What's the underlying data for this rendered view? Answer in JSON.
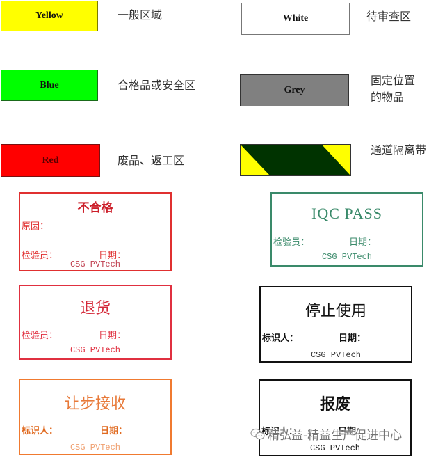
{
  "color_legend": [
    {
      "swatch_label": "Yellow",
      "description": "一般区域",
      "color": "#ffff00"
    },
    {
      "swatch_label": "White",
      "description": "待审查区",
      "color": "#ffffff"
    },
    {
      "swatch_label": "Blue",
      "description": "合格品或安全区",
      "color": "#00ff00"
    },
    {
      "swatch_label": "Grey",
      "description": "固定位置的物品",
      "description_lines": [
        "固定位置",
        "的物品"
      ],
      "color": "#808080"
    },
    {
      "swatch_label": "Red",
      "description": "废品、返工区",
      "color": "#ff0000"
    },
    {
      "swatch_label": "",
      "description": "通道隔离带",
      "color": "#003300",
      "stripe_color": "#ffff00"
    }
  ],
  "labels": [
    {
      "title": "不合格",
      "fields": [
        "原因：",
        "检验员：",
        "日期："
      ],
      "footer": "CSG PVTech",
      "color": "#e03030"
    },
    {
      "title": "IQC PASS",
      "fields": [
        "检验员：",
        "日期："
      ],
      "footer": "CSG PVTech",
      "color": "#3a8a6a"
    },
    {
      "title": "退货",
      "fields": [
        "检验员：",
        "日期："
      ],
      "footer": "CSG PVTech",
      "color": "#e03040"
    },
    {
      "title": "停止使用",
      "fields": [
        "标识人：",
        "日期："
      ],
      "footer": "CSG PVTech",
      "color": "#111111"
    },
    {
      "title": "让步接收",
      "fields": [
        "标识人：",
        "日期："
      ],
      "footer": "CSG PVTech",
      "color": "#f07a30"
    },
    {
      "title": "报废",
      "fields": [
        "标识人：",
        "日期："
      ],
      "footer": "CSG PVTech",
      "color": "#111111"
    }
  ],
  "watermark": {
    "icon": "wechat-icon",
    "text": "精弘益-精益生产促进中心"
  }
}
